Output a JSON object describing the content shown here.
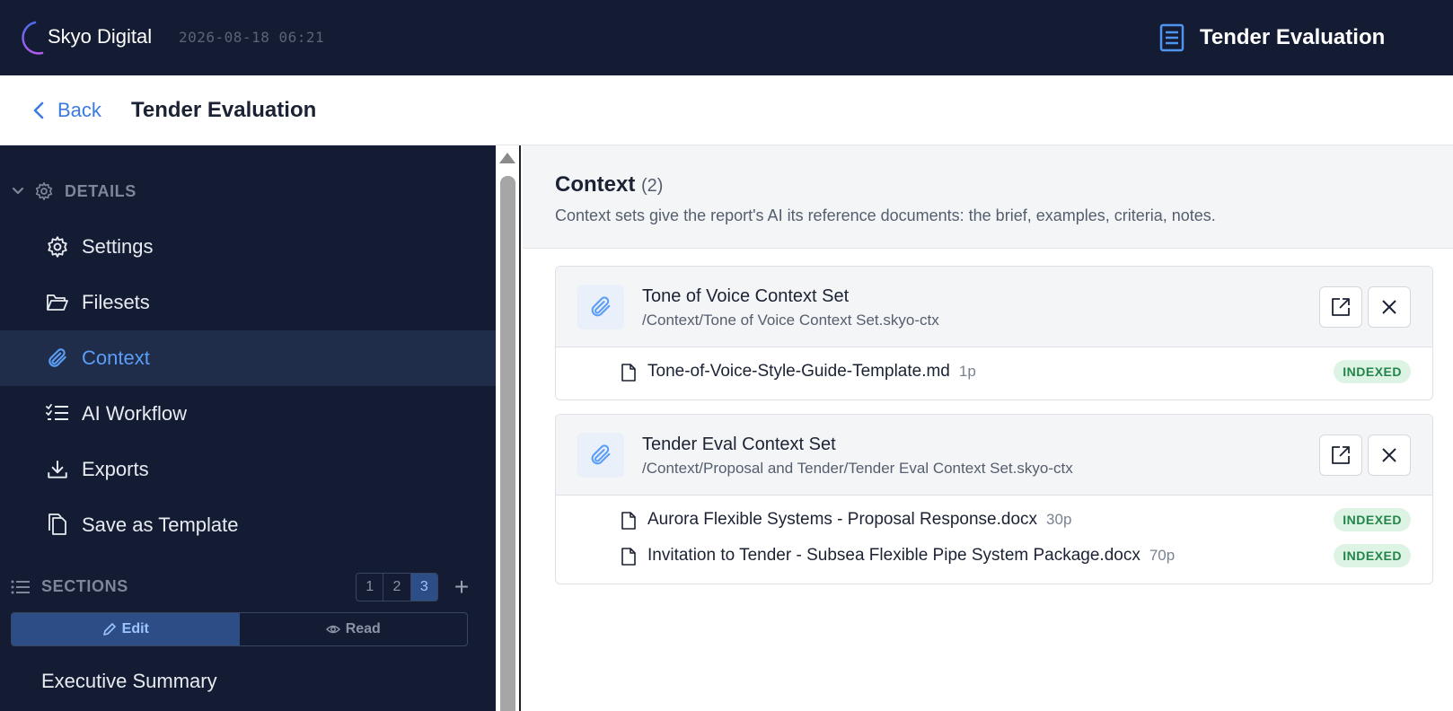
{
  "topbar": {
    "brand": "Skyo Digital",
    "timestamp": "2026-08-18 06:21",
    "report_title": "Tender Evaluation",
    "report_icon": "document-icon"
  },
  "subheader": {
    "back_label": "Back",
    "page_title": "Tender Evaluation"
  },
  "sidebar": {
    "details_heading": "DETAILS",
    "items": [
      {
        "label": "Settings",
        "icon": "gear-icon"
      },
      {
        "label": "Filesets",
        "icon": "folder-open-icon"
      },
      {
        "label": "Context",
        "icon": "paperclip-icon",
        "active": true
      },
      {
        "label": "AI Workflow",
        "icon": "checklist-icon"
      },
      {
        "label": "Exports",
        "icon": "download-icon"
      },
      {
        "label": "Save as Template",
        "icon": "copy-icon"
      }
    ],
    "sections_heading": "SECTIONS",
    "pages": [
      "1",
      "2",
      "3"
    ],
    "selected_page": "3",
    "add_label": "+",
    "mode_edit": "Edit",
    "mode_read": "Read",
    "active_mode": "Edit",
    "section_items": [
      "Executive Summary"
    ]
  },
  "main": {
    "title": "Context",
    "count": "(2)",
    "description": "Context sets give the report's AI its reference documents: the brief, examples, criteria, notes.",
    "cards": [
      {
        "name": "Tone of Voice Context Set",
        "path": "/Context/Tone of Voice Context Set.skyo-ctx",
        "files": [
          {
            "name": "Tone-of-Voice-Style-Guide-Template.md",
            "pages": "1p",
            "status": "INDEXED"
          }
        ]
      },
      {
        "name": "Tender Eval Context Set",
        "path": "/Context/Proposal and Tender/Tender Eval Context Set.skyo-ctx",
        "files": [
          {
            "name": "Aurora Flexible Systems - Proposal Response.docx",
            "pages": "30p",
            "status": "INDEXED"
          },
          {
            "name": "Invitation to Tender - Subsea Flexible Pipe System Package.docx",
            "pages": "70p",
            "status": "INDEXED"
          }
        ]
      }
    ]
  },
  "colors": {
    "topbar_bg": "#131c33",
    "accent": "#3b7be0",
    "indexed_badge_bg": "#ddf3e4",
    "indexed_badge_fg": "#23854a"
  }
}
